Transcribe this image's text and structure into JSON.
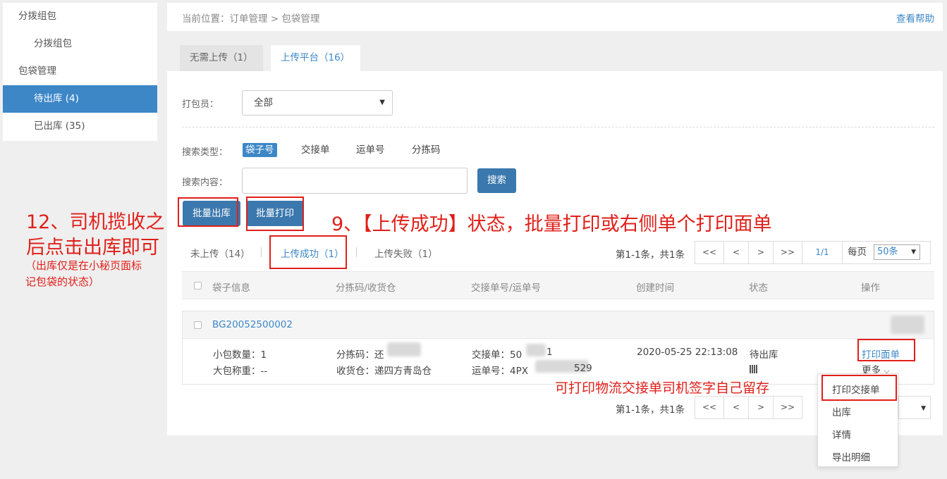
{
  "sidebar": {
    "items": [
      {
        "label": "分拨组包"
      },
      {
        "label": "分拨组包"
      },
      {
        "label": "包袋管理"
      },
      {
        "label": "待出库 (4)"
      },
      {
        "label": "已出库 (35)"
      }
    ]
  },
  "header": {
    "breadcrumb": "当前位置：订单管理 > 包袋管理",
    "help": "查看帮助"
  },
  "tabs": [
    {
      "label": "无需上传（1）"
    },
    {
      "label": "上传平台（16）"
    }
  ],
  "filters": {
    "packer_label": "打包员：",
    "packer_value": "全部",
    "search_type_label": "搜索类型：",
    "search_types": [
      "袋子号",
      "交接单",
      "运单号",
      "分拣码"
    ],
    "search_content_label": "搜索内容：",
    "search_value": "",
    "search_button": "搜索"
  },
  "actions": {
    "batch_out": "批量出库",
    "batch_print": "批量打印"
  },
  "subtabs": [
    {
      "label": "未上传（14）"
    },
    {
      "label": "上传成功（1）"
    },
    {
      "label": "上传失败（1）"
    }
  ],
  "pagination": {
    "info": "第1-1条，共1条",
    "first": "<<",
    "prev": "<",
    "next": ">",
    "last": ">>",
    "page": "1/1",
    "per_page_label": "每页",
    "per_page_value": "50条"
  },
  "table": {
    "headers": [
      "袋子信息",
      "分拣码/收货仓",
      "交接单号/运单号",
      "创建时间",
      "状态",
      "操作"
    ],
    "rows": [
      {
        "bag_no": "BG20052500002",
        "small_count": "小包数量：1",
        "big_weight": "大包称重：--",
        "sort_code": "分拣码：还",
        "warehouse": "收货仓：递四方青岛仓",
        "handover": "交接单：50",
        "handover_tail": "1",
        "waybill": "运单号：4PX",
        "waybill_tail": "529",
        "created": "2020-05-25 22:13:08",
        "status": "待出库",
        "op_print": "打印面单",
        "op_more": "更多"
      }
    ]
  },
  "more_menu": [
    "打印交接单",
    "出库",
    "详情",
    "导出明细"
  ],
  "annotations": {
    "left_line1": "12、司机揽收之",
    "left_line2": "后点击出库即可",
    "left_note1": "（出库仅是在小秘页面标",
    "left_note2": "记包袋的状态）",
    "step9": "9、【上传成功】状态，批量打印或右侧单个打印面单",
    "print_note": "可打印物流交接单司机签字自己留存"
  },
  "colors": {
    "accent": "#3d87c7",
    "annotation_red": "#e0201a",
    "button_blue": "#3b78ad"
  }
}
